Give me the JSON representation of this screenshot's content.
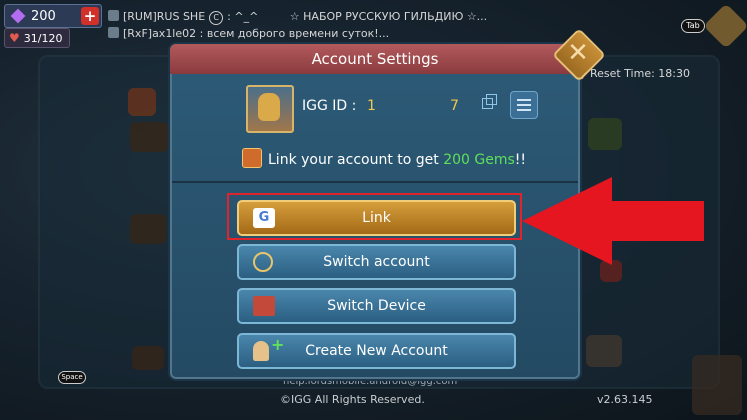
{
  "hud": {
    "gems_value": "200",
    "plus_label": "+",
    "stamina": "31/120"
  },
  "chat": {
    "line1_prefix": "[RUM]RUS SHE",
    "line1_badge": "C",
    "line1_text": ": ^_^",
    "line1_extra": "☆ НАБОР РУССКУЮ ГИЛЬДИЮ ☆...",
    "line2": "[RxF]ax1le02 : всем доброго времени суток!..."
  },
  "keys": {
    "tab": "Tab",
    "space": "Space"
  },
  "background": {
    "reset_time": "y Reset Time: 18:30",
    "footer_url": "help.lordsmobile.android@igg.com",
    "copyright": "©IGG All Rights Reserved.",
    "version": "v2.63.145"
  },
  "dialog": {
    "title": "Account Settings",
    "close_label": "✕",
    "igg_label": "IGG ID :",
    "igg_value": "1",
    "igg_extra": "7",
    "promo_pre": "Link your account to get ",
    "promo_gems": "200 Gems",
    "promo_post": "!!",
    "buttons": [
      {
        "label": "Link",
        "icon": "google-icon"
      },
      {
        "label": "Switch account",
        "icon": "switch-account-icon"
      },
      {
        "label": "Switch Device",
        "icon": "switch-device-icon"
      },
      {
        "label": "Create New Account",
        "icon": "add-user-icon"
      }
    ],
    "google_glyph": "G"
  },
  "colors": {
    "highlight_red": "#e0242b",
    "link_gold": "#c48a2c",
    "gems_green": "#5ee05a",
    "igg_gold": "#f0c84f"
  }
}
